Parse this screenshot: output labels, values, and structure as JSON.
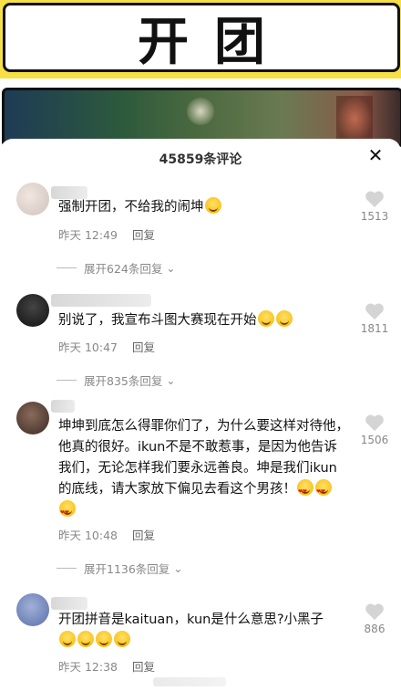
{
  "banner": {
    "title": "开团"
  },
  "sheet": {
    "title": "45859条评论",
    "close_symbol": "✕"
  },
  "comments": [
    {
      "text": "强制开团，不给我的闹坤",
      "emoji_count": 1,
      "time": "昨天 12:49",
      "reply": "回复",
      "likes": "1513",
      "expand": "展开624条回复"
    },
    {
      "text": "别说了，我宣布斗图大赛现在开始",
      "emoji_count": 2,
      "time": "昨天 10:47",
      "reply": "回复",
      "likes": "1811",
      "expand": "展开835条回复"
    },
    {
      "text": "坤坤到底怎么得罪你们了，为什么要这样对待他，他真的很好。ikun不是不敢惹事，是因为他告诉我们，无论怎样我们要永远善良。坤是我们ikun的底线，请大家放下偏见去看这个男孩！",
      "emoji_count": 3,
      "time": "昨天 10:48",
      "reply": "回复",
      "likes": "1506",
      "expand": "展开1136条回复"
    },
    {
      "text": "开团拼音是kaituan，kun是什么意思?小黑子",
      "emoji_count": 4,
      "time": "昨天 12:38",
      "reply": "回复",
      "likes": "886"
    }
  ],
  "colors": {
    "banner_bg": "#f6e046",
    "text_muted": "#888888"
  },
  "icons": {
    "like": "heart-icon",
    "expand": "chevron-down-icon",
    "close": "close-icon"
  }
}
